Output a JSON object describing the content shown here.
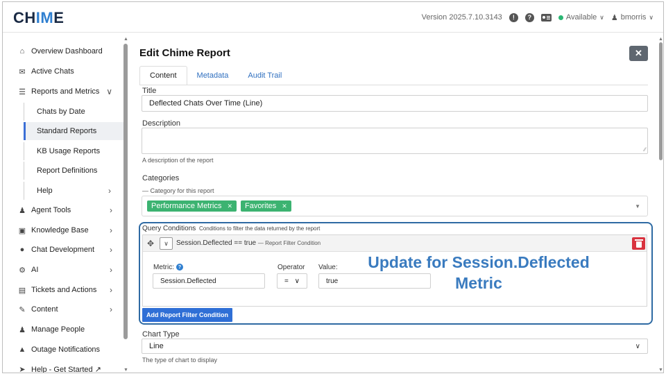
{
  "header": {
    "logo_prefix": "CH",
    "logo_accent": "IM",
    "logo_suffix": "E",
    "version": "Version 2025.7.10.3143",
    "status": "Available",
    "username": "bmorris"
  },
  "sidebar": {
    "items": [
      {
        "label": "Overview Dashboard",
        "icon": "home-icon"
      },
      {
        "label": "Active Chats",
        "icon": "chat-bubbles-icon"
      },
      {
        "label": "Reports and Metrics",
        "icon": "chart-icon",
        "expanded": true
      },
      {
        "label": "Agent Tools",
        "icon": "users-icon"
      },
      {
        "label": "Knowledge Base",
        "icon": "book-icon"
      },
      {
        "label": "Chat Development",
        "icon": "comment-icon"
      },
      {
        "label": "AI",
        "icon": "robot-icon"
      },
      {
        "label": "Tickets and Actions",
        "icon": "ticket-icon"
      },
      {
        "label": "Content",
        "icon": "edit-icon"
      },
      {
        "label": "Manage People",
        "icon": "person-icon"
      },
      {
        "label": "Outage Notifications",
        "icon": "warning-icon"
      },
      {
        "label": "Help - Get Started ↗",
        "icon": "rocket-icon"
      }
    ],
    "sub_items": [
      {
        "label": "Chats by Date"
      },
      {
        "label": "Standard Reports",
        "active": true
      },
      {
        "label": "KB Usage Reports"
      },
      {
        "label": "Report Definitions"
      },
      {
        "label": "Help"
      }
    ]
  },
  "main": {
    "title": "Edit Chime Report",
    "close_label": "✕",
    "tabs": [
      {
        "label": "Content",
        "active": true
      },
      {
        "label": "Metadata"
      },
      {
        "label": "Audit Trail"
      }
    ],
    "title_label": "Title",
    "title_value": "Deflected Chats Over Time (Line)",
    "description_label": "Description",
    "description_help": "A description of the report",
    "categories_label": "Categories",
    "categories_help": "— Category for this report",
    "categories": [
      "Performance Metrics",
      "Favorites"
    ],
    "query": {
      "label": "Query Conditions",
      "help": "Conditions to filter the data returned by the report",
      "condition_summary": "Session.Deflected == true",
      "condition_type": "— Report Filter Condition",
      "metric_label": "Metric:",
      "metric_value": "Session.Deflected",
      "operator_label": "Operator",
      "operator_value": "=",
      "value_label": "Value:",
      "value_value": "true",
      "add_button": "Add Report Filter Condition"
    },
    "annotation_line1": "Update for Session.Deflected",
    "annotation_line2": "Metric",
    "chart_type_label": "Chart Type",
    "chart_type_value": "Line",
    "chart_type_help": "The type of chart to display"
  },
  "colors": {
    "accent": "#2f7fd0",
    "pill": "#3cb371",
    "delete": "#d9333f",
    "highlight": "#2e6aa3",
    "annotation": "#3a7bbf"
  }
}
